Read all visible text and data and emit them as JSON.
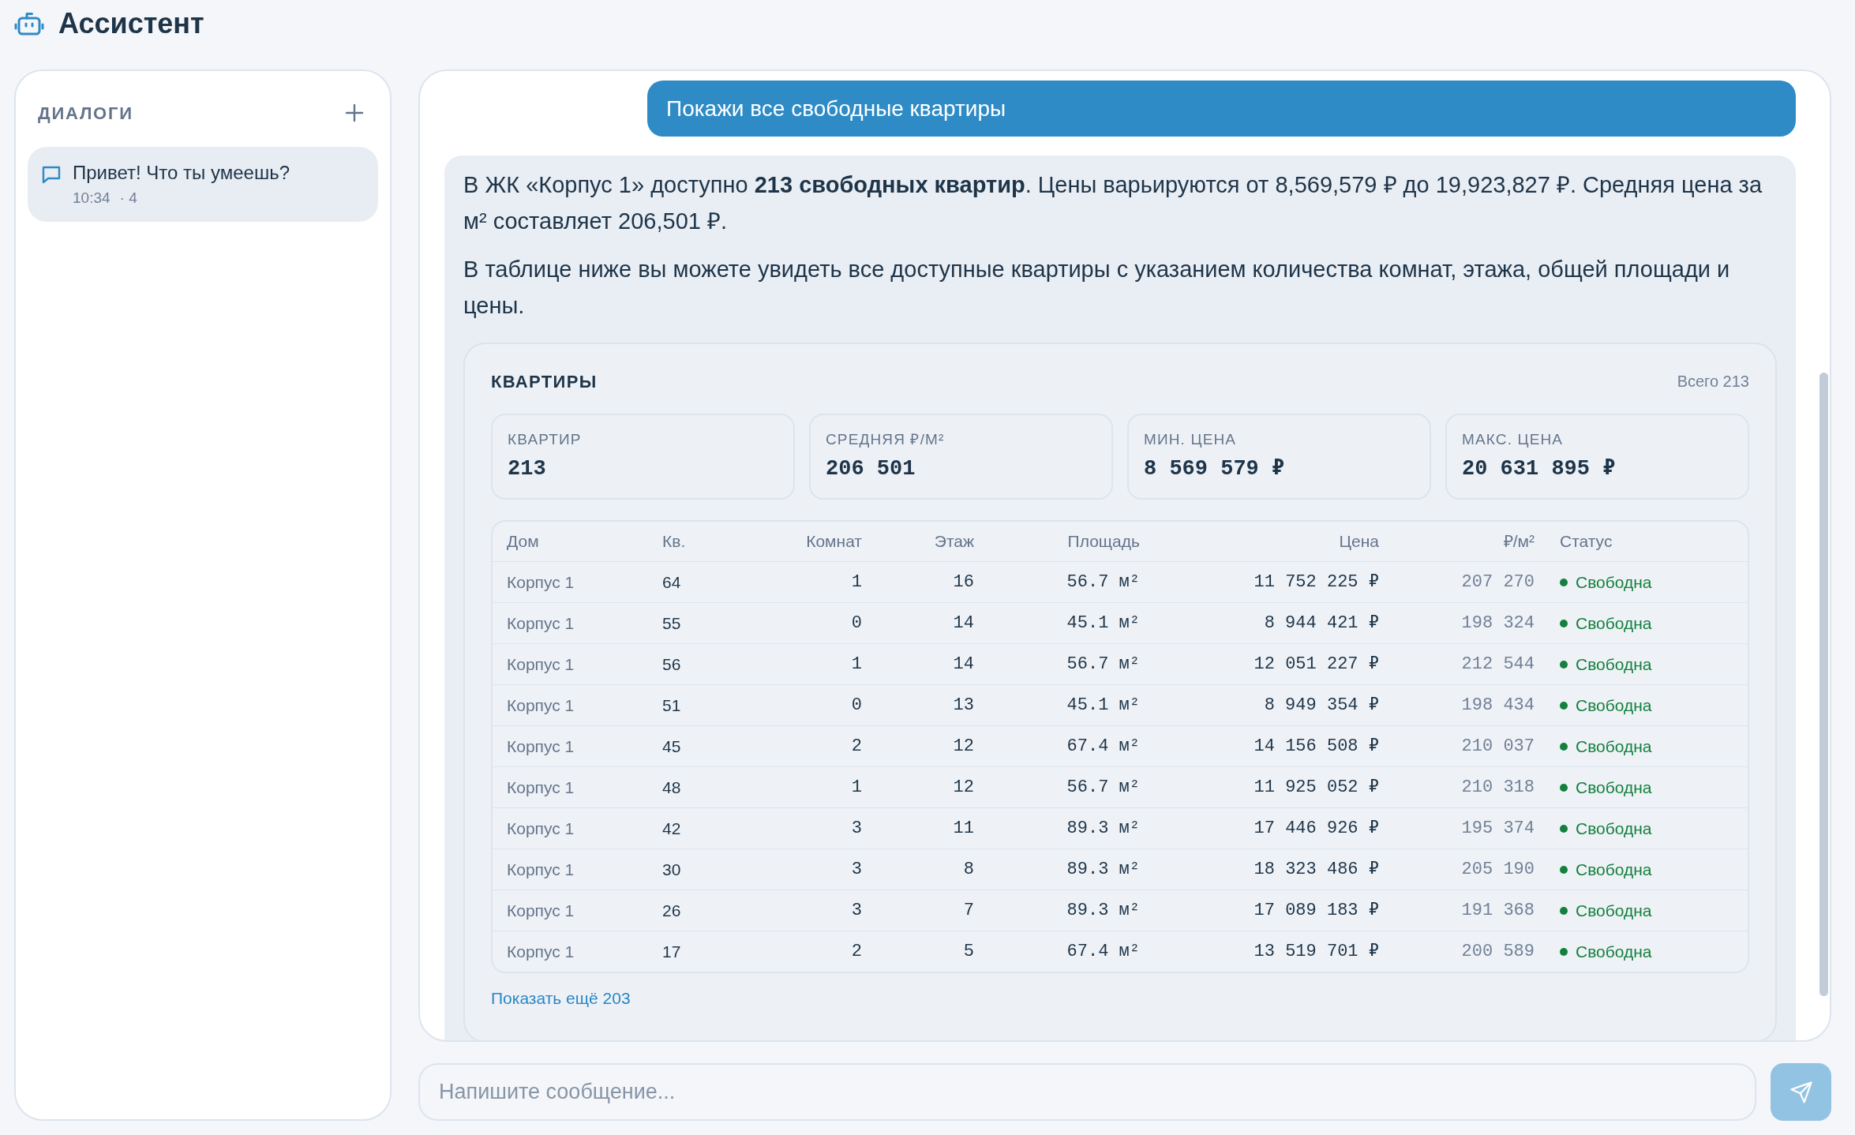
{
  "header": {
    "title": "Ассистент"
  },
  "sidebar": {
    "title": "ДИАЛОГИ",
    "items": [
      {
        "title": "Привет! Что ты умеешь?",
        "time": "10:34",
        "messages": "· 4",
        "selected": true
      }
    ]
  },
  "chat": {
    "messages": [
      {
        "kind": "user",
        "text": "Покажи все свободные квартиры"
      },
      {
        "kind": "assistant",
        "paragraphs": [
          "В ЖК «Корпус 1» доступно **213 свободных квартир**. Цены варьируются от 8,569,579 ₽ до 19,923,827 ₽. Средняя цена за м² составляет 206,501 ₽.",
          "В таблице ниже вы можете увидеть все доступные квартиры с указанием количества комнат, этажа, общей площади и цены."
        ],
        "card": {
          "title": "КВАРТИРЫ",
          "total": "Всего 213",
          "stats": [
            {
              "label": "КВАРТИР",
              "value": "213"
            },
            {
              "label": "СРЕДНЯЯ ₽/М²",
              "value": "206 501"
            },
            {
              "label": "МИН. ЦЕНА",
              "value": "8 569 579 ₽"
            },
            {
              "label": "МАКС. ЦЕНА",
              "value": "20 631 895 ₽"
            }
          ],
          "table": {
            "columns": [
              "Дом",
              "Кв.",
              "Комнат",
              "Этаж",
              "Площадь",
              "Цена",
              "₽/м²",
              "Статус"
            ],
            "rows": [
              {
                "house": "Корпус 1",
                "apartment": "64",
                "rooms": "1",
                "floor": "16",
                "area": "56.7 м²",
                "price": "11 752 225 ₽",
                "price_per_m2": "207 270",
                "status": "Свободна"
              },
              {
                "house": "Корпус 1",
                "apartment": "55",
                "rooms": "0",
                "floor": "14",
                "area": "45.1 м²",
                "price": "8 944 421 ₽",
                "price_per_m2": "198 324",
                "status": "Свободна"
              },
              {
                "house": "Корпус 1",
                "apartment": "56",
                "rooms": "1",
                "floor": "14",
                "area": "56.7 м²",
                "price": "12 051 227 ₽",
                "price_per_m2": "212 544",
                "status": "Свободна"
              },
              {
                "house": "Корпус 1",
                "apartment": "51",
                "rooms": "0",
                "floor": "13",
                "area": "45.1 м²",
                "price": "8 949 354 ₽",
                "price_per_m2": "198 434",
                "status": "Свободна"
              },
              {
                "house": "Корпус 1",
                "apartment": "45",
                "rooms": "2",
                "floor": "12",
                "area": "67.4 м²",
                "price": "14 156 508 ₽",
                "price_per_m2": "210 037",
                "status": "Свободна"
              },
              {
                "house": "Корпус 1",
                "apartment": "48",
                "rooms": "1",
                "floor": "12",
                "area": "56.7 м²",
                "price": "11 925 052 ₽",
                "price_per_m2": "210 318",
                "status": "Свободна"
              },
              {
                "house": "Корпус 1",
                "apartment": "42",
                "rooms": "3",
                "floor": "11",
                "area": "89.3 м²",
                "price": "17 446 926 ₽",
                "price_per_m2": "195 374",
                "status": "Свободна"
              },
              {
                "house": "Корпус 1",
                "apartment": "30",
                "rooms": "3",
                "floor": "8",
                "area": "89.3 м²",
                "price": "18 323 486 ₽",
                "price_per_m2": "205 190",
                "status": "Свободна"
              },
              {
                "house": "Корпус 1",
                "apartment": "26",
                "rooms": "3",
                "floor": "7",
                "area": "89.3 м²",
                "price": "17 089 183 ₽",
                "price_per_m2": "191 368",
                "status": "Свободна"
              },
              {
                "house": "Корпус 1",
                "apartment": "17",
                "rooms": "2",
                "floor": "5",
                "area": "67.4 м²",
                "price": "13 519 701 ₽",
                "price_per_m2": "200 589",
                "status": "Свободна"
              }
            ]
          },
          "more_link": "Показать ещё 203"
        }
      }
    ]
  },
  "composer": {
    "placeholder": "Напишите сообщение...",
    "send_button": {
      "disabled": true
    }
  }
}
